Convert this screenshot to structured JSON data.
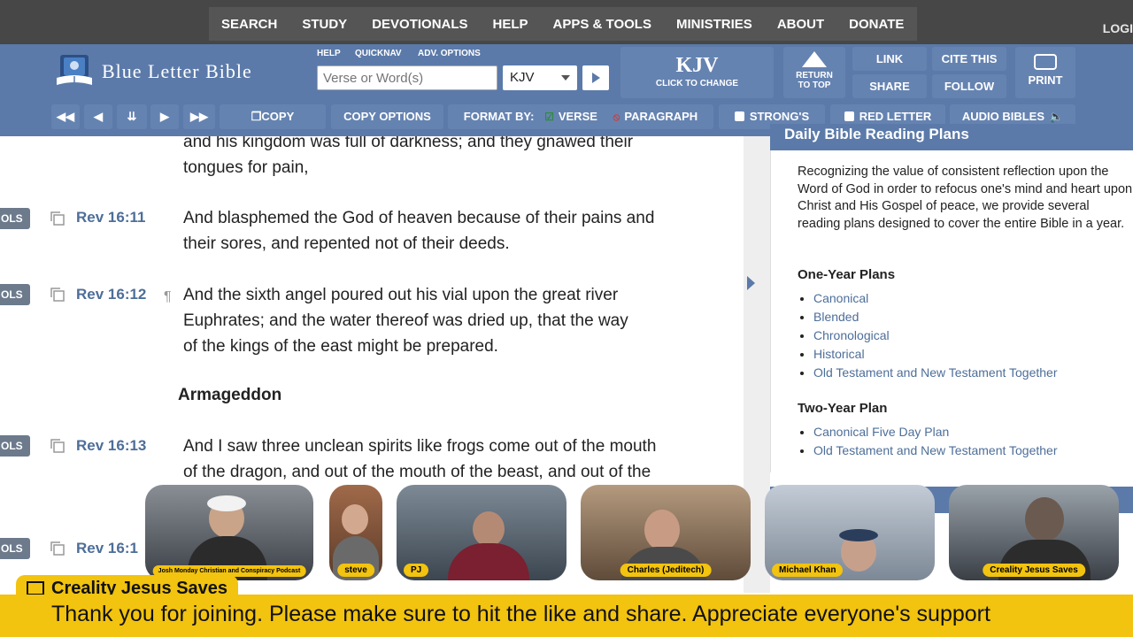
{
  "topnav": {
    "items": [
      "SEARCH",
      "STUDY",
      "DEVOTIONALS",
      "HELP",
      "APPS & TOOLS",
      "MINISTRIES",
      "ABOUT",
      "DONATE"
    ],
    "login": "LOGI"
  },
  "header": {
    "logo_text": "Blue Letter Bible",
    "help": "HELP",
    "quicknav": "QUICKNAV",
    "adv_options": "ADV. OPTIONS",
    "search_placeholder": "Verse or Word(s)",
    "version": "KJV",
    "kjv_big": "KJV",
    "kjv_small": "CLICK TO CHANGE",
    "return_top_1": "RETURN",
    "return_top_2": "TO TOP",
    "link": "LINK",
    "cite_this": "CITE THIS",
    "share": "SHARE",
    "follow": "FOLLOW",
    "print": "PRINT"
  },
  "toolbar": {
    "copy": "COPY",
    "copy_options": "COPY OPTIONS",
    "format_by": "FORMAT BY:",
    "verse": "VERSE",
    "paragraph": "PARAGRAPH",
    "strongs": "STRONG'S",
    "red_letter": "RED LETTER",
    "audio_bibles": "AUDIO BIBLES"
  },
  "content": {
    "tools_label": "OLS",
    "partial_lines": [
      "and his kingdom was full of darkness; and they gnawed their",
      "tongues for pain,"
    ],
    "verses": [
      {
        "ref": "Rev 16:11",
        "lines": [
          "And blasphemed the God of heaven because of their pains and",
          "their sores, and repented not of their deeds."
        ]
      },
      {
        "ref": "Rev 16:12",
        "lines": [
          "And the sixth angel poured out his vial upon the great river",
          "Euphrates; and the water thereof was dried up, that the way",
          "of the kings of the east might be prepared."
        ]
      },
      {
        "ref": "Rev 16:13",
        "lines": [
          "And I saw three unclean spirits like frogs come out of the mouth",
          "of the dragon, and out of the mouth of the beast, and out of the"
        ]
      },
      {
        "ref": "Rev 16:1"
      }
    ],
    "heading": "Armageddon",
    "pilcrow": "¶"
  },
  "sidebar": {
    "title": "Daily Bible Reading Plans",
    "intro": "Recognizing the value of consistent reflection upon the Word of God in order to refocus one's mind and heart upon Christ and His Gospel of peace, we provide several reading plans designed to cover the entire Bible in a year.",
    "one_year_title": "One-Year Plans",
    "one_year": [
      "Canonical",
      "Blended",
      "Chronological",
      "Historical",
      "Old Testament and New Testament Together"
    ],
    "two_year_title": "Two-Year Plan",
    "two_year": [
      "Canonical Five Day Plan",
      "Old Testament and New Testament Together"
    ]
  },
  "stream": {
    "participants": [
      "Josh Monday Christian and Conspiracy Podcast",
      "steve",
      "PJ",
      "Charles (Jeditech)",
      "Michael Khan",
      "Creality Jesus Saves"
    ],
    "banner_name": "Creality Jesus Saves",
    "ticker": "Thank you for joining. Please make sure to hit the like and share. Appreciate everyone's support"
  },
  "colors": {
    "nav_bg": "#474747",
    "header_bg": "#5b7aa9",
    "link": "#4d6e99",
    "ticker": "#f2c30f"
  }
}
